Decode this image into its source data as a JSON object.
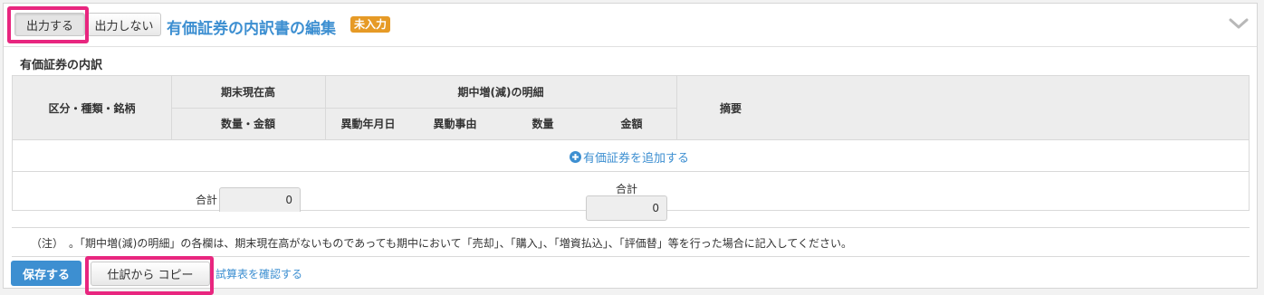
{
  "header": {
    "output_on": "出力する",
    "output_off": "出力しない",
    "title": "有価証券の内訳書の編集",
    "status_badge": "未入力"
  },
  "section": {
    "label": "有価証券の内訳"
  },
  "table": {
    "col_category": "区分・種類・銘柄",
    "col_period_end": "期末現在高",
    "col_period_end_sub": "数量・金額",
    "col_changes": "期中増(減)の明細",
    "col_change_date": "異動年月日",
    "col_change_reason": "異動事由",
    "col_quantity": "数量",
    "col_amount": "金額",
    "col_remarks": "摘要",
    "add_link": "有価証券を追加する",
    "total_label_1": "合計",
    "total_value_1": "0",
    "total_label_2": "合計",
    "total_value_2": "0"
  },
  "note": "（注）　。「期中増(減)の明細」の各欄は、期末現在高がないものであっても期中において「売却」、「購入」、「増資払込」、「評価替」等を行った場合に記入してください。",
  "footer": {
    "save": "保存する",
    "copy": "仕訳から コピー",
    "check_link": "試算表を確認する"
  },
  "colors": {
    "accent": "#3d8fd1",
    "badge": "#e69a26",
    "highlight": "#e8267f"
  },
  "icons": {
    "collapse": "chevron-down-icon",
    "add": "plus-circle-icon"
  }
}
